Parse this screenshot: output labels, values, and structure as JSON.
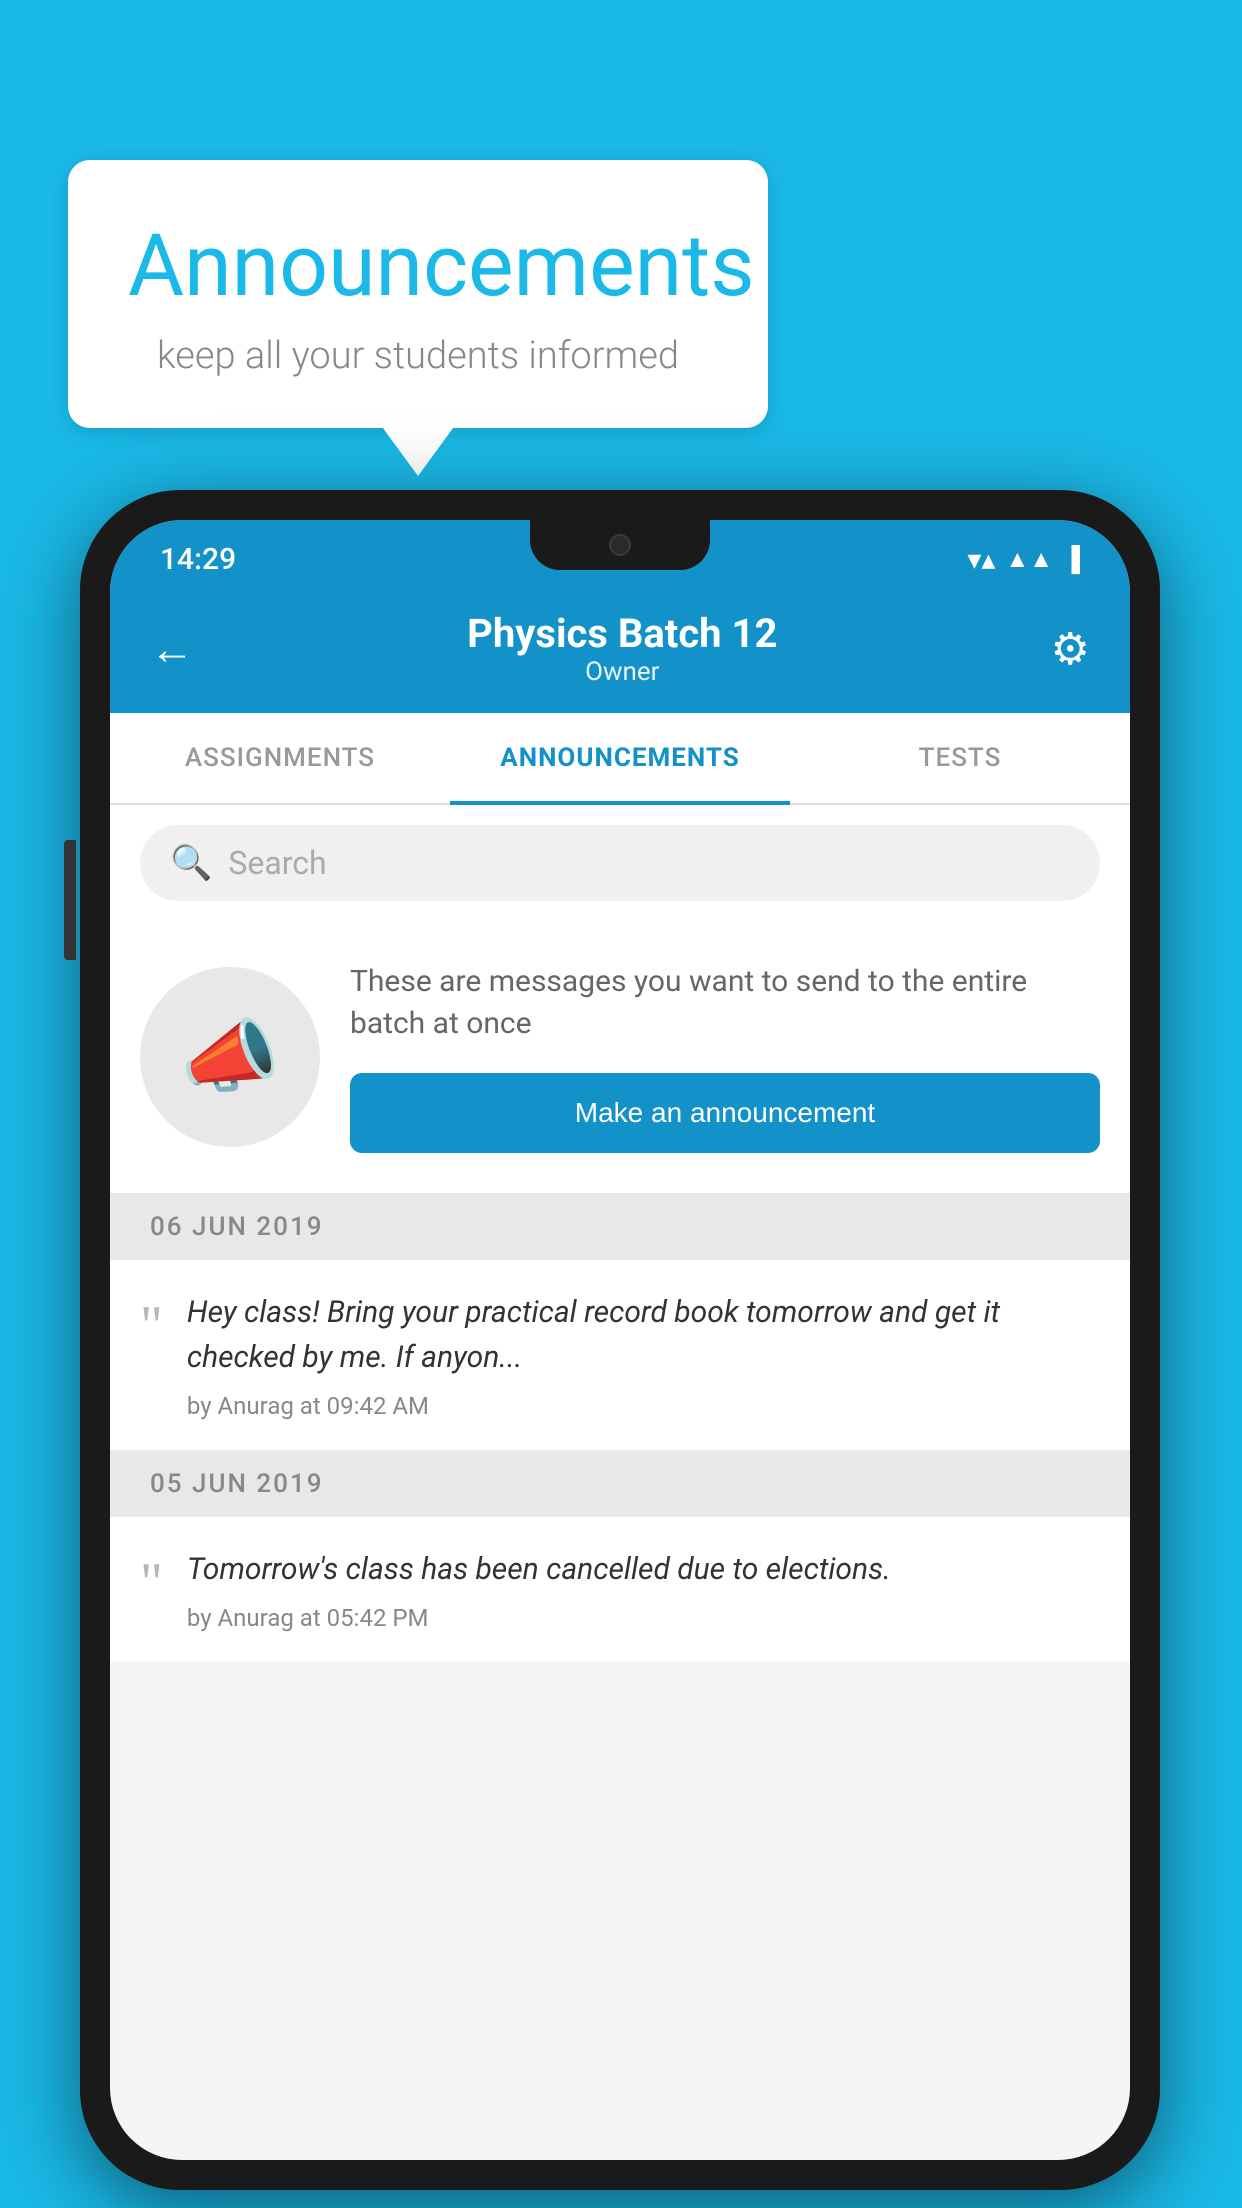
{
  "background": {
    "color": "#1ab9e8"
  },
  "speech_bubble": {
    "title": "Announcements",
    "subtitle": "keep all your students informed"
  },
  "status_bar": {
    "time": "14:29"
  },
  "header": {
    "title": "Physics Batch 12",
    "subtitle": "Owner",
    "back_label": "←",
    "gear_label": "⚙"
  },
  "tabs": [
    {
      "label": "ASSIGNMENTS",
      "active": false
    },
    {
      "label": "ANNOUNCEMENTS",
      "active": true
    },
    {
      "label": "TESTS",
      "active": false
    }
  ],
  "search": {
    "placeholder": "Search"
  },
  "announcement_prompt": {
    "description": "These are messages you want to send to the entire batch at once",
    "button_label": "Make an announcement"
  },
  "announcements": [
    {
      "date": "06  JUN  2019",
      "text": "Hey class! Bring your practical record book tomorrow and get it checked by me. If anyon...",
      "meta": "by Anurag at 09:42 AM"
    },
    {
      "date": "05  JUN  2019",
      "text": "Tomorrow's class has been cancelled due to elections.",
      "meta": "by Anurag at 05:42 PM"
    }
  ]
}
